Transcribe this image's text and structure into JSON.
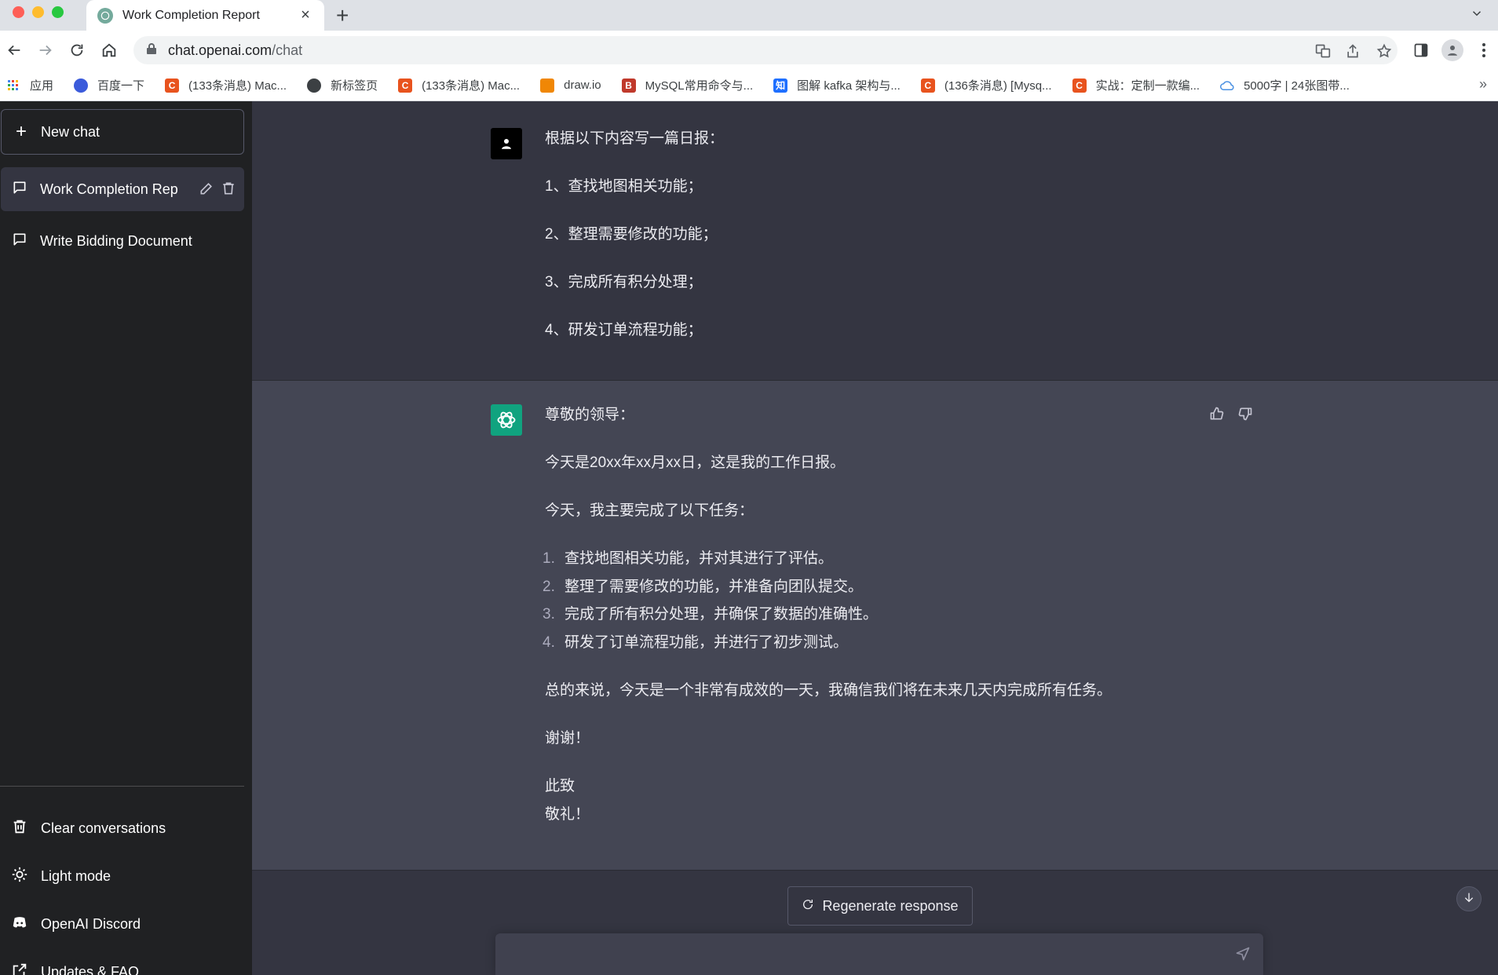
{
  "browser": {
    "tab_title": "Work Completion Report",
    "new_tab": "+",
    "close_tab": "×",
    "url_host": "chat.openai.com",
    "url_path": "/chat",
    "bookmarks": [
      {
        "label": "应用",
        "color": "#4285f4"
      },
      {
        "label": "百度一下",
        "color": "#3b5bdb"
      },
      {
        "label": "(133条消息) Mac...",
        "color": "#e8531e"
      },
      {
        "label": "新标签页",
        "color": "#3c4043"
      },
      {
        "label": "(133条消息) Mac...",
        "color": "#e8531e"
      },
      {
        "label": "draw.io",
        "color": "#f08705"
      },
      {
        "label": "MySQL常用命令与...",
        "color": "#c0392b"
      },
      {
        "label": "图解 kafka 架构与...",
        "color": "#1e6fff"
      },
      {
        "label": "(136条消息) [Mysq...",
        "color": "#e8531e"
      },
      {
        "label": "实战：定制一款编...",
        "color": "#e8531e"
      },
      {
        "label": "5000字 | 24张图带...",
        "color": "#4a90e2"
      }
    ],
    "bookmarks_more": "»"
  },
  "sidebar": {
    "new_chat": "New chat",
    "conversations": [
      {
        "label": "Work Completion Rep",
        "active": true
      },
      {
        "label": "Write Bidding Document",
        "active": false
      }
    ],
    "links": [
      {
        "label": "Clear conversations",
        "icon": "trash-icon"
      },
      {
        "label": "Light mode",
        "icon": "sun-icon"
      },
      {
        "label": "OpenAI Discord",
        "icon": "discord-icon"
      },
      {
        "label": "Updates & FAQ",
        "icon": "external-link-icon"
      }
    ]
  },
  "messages": {
    "user": {
      "lines": [
        "根据以下内容写一篇日报：",
        "1、查找地图相关功能；",
        "2、整理需要修改的功能；",
        "3、完成所有积分处理；",
        "4、研发订单流程功能；"
      ]
    },
    "assistant": {
      "greeting": "尊敬的领导：",
      "intro": "今天是20xx年xx月xx日，这是我的工作日报。",
      "tasks_intro": "今天，我主要完成了以下任务：",
      "tasks": [
        {
          "num": "1.",
          "text": "查找地图相关功能，并对其进行了评估。"
        },
        {
          "num": "2.",
          "text": "整理了需要修改的功能，并准备向团队提交。"
        },
        {
          "num": "3.",
          "text": "完成了所有积分处理，并确保了数据的准确性。"
        },
        {
          "num": "4.",
          "text": "研发了订单流程功能，并进行了初步测试。"
        }
      ],
      "summary": "总的来说，今天是一个非常有成效的一天，我确信我们将在未来几天内完成所有任务。",
      "thanks": "谢谢！",
      "closing_1": "此致",
      "closing_2": "敬礼！"
    }
  },
  "actions": {
    "regenerate": "Regenerate response",
    "input_placeholder": ""
  }
}
